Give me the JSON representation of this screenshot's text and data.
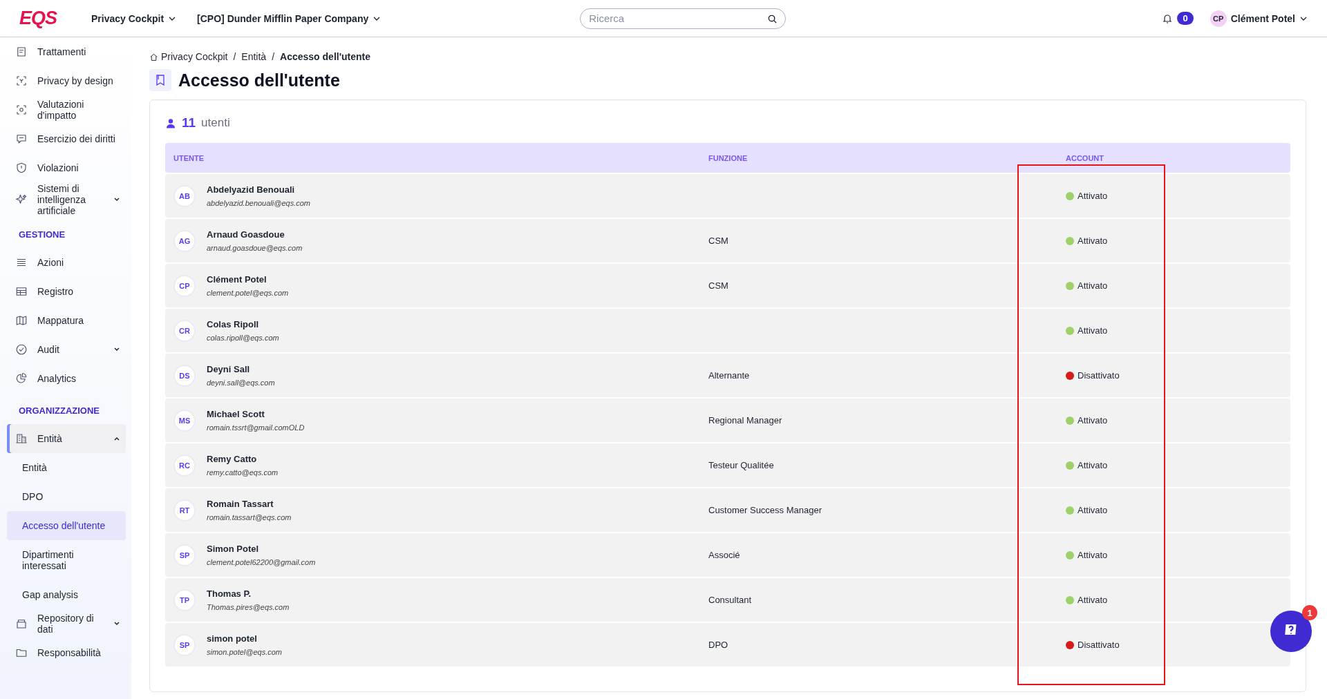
{
  "header": {
    "logo": "EQS",
    "menus": [
      {
        "label": "Privacy Cockpit"
      },
      {
        "label": "[CPO] Dunder Mifflin Paper Company"
      }
    ],
    "search": {
      "placeholder": "Ricerca"
    },
    "notifications": "0",
    "user": {
      "initials": "CP",
      "name": "Clément Potel"
    }
  },
  "sidebar": {
    "items": [
      {
        "kind": "item",
        "label": "Trattamenti",
        "selected": false
      },
      {
        "kind": "item",
        "label": "Privacy by design",
        "selected": false
      },
      {
        "kind": "item",
        "label": "Valutazioni d'impatto",
        "selected": false
      },
      {
        "kind": "item",
        "label": "Esercizio dei diritti",
        "selected": false
      },
      {
        "kind": "item",
        "label": "Violazioni",
        "selected": false
      },
      {
        "kind": "group",
        "label": "Sistemi di intelligenza artificiale",
        "expanded": false,
        "selected": false
      },
      {
        "kind": "section",
        "label": "GESTIONE"
      },
      {
        "kind": "item",
        "label": "Azioni",
        "selected": false
      },
      {
        "kind": "item",
        "label": "Registro",
        "selected": false
      },
      {
        "kind": "item",
        "label": "Mappatura",
        "selected": false
      },
      {
        "kind": "group",
        "label": "Audit",
        "expanded": false,
        "selected": false
      },
      {
        "kind": "item",
        "label": "Analytics",
        "selected": false
      },
      {
        "kind": "section",
        "label": "ORGANIZZAZIONE"
      },
      {
        "kind": "group",
        "label": "Entità",
        "expanded": true,
        "selected": true,
        "children": [
          {
            "label": "Entità",
            "selected": false
          },
          {
            "label": "DPO",
            "selected": false
          },
          {
            "label": "Accesso dell'utente",
            "selected": true
          },
          {
            "label": "Dipartimenti interessati",
            "selected": false
          },
          {
            "label": "Gap analysis",
            "selected": false
          }
        ]
      },
      {
        "kind": "group",
        "label": "Repository di dati",
        "expanded": false,
        "selected": false
      },
      {
        "kind": "item",
        "label": "Responsabilità",
        "selected": false
      }
    ]
  },
  "breadcrumb": {
    "separator": "/",
    "items": [
      {
        "label": "Privacy Cockpit"
      },
      {
        "label": "Entità"
      },
      {
        "label": "Accesso dell'utente"
      }
    ]
  },
  "page_title": "Accesso dell'utente",
  "count": {
    "number": "11",
    "label": "utenti"
  },
  "table": {
    "columns": [
      "UTENTE",
      "FUNZIONE",
      "ACCOUNT"
    ],
    "rows": [
      {
        "initials": "AB",
        "name": "Abdelyazid Benouali",
        "email": "abdelyazid.benouali@eqs.com",
        "function": "",
        "status": "Attivato",
        "color": "#9fd16b"
      },
      {
        "initials": "AG",
        "name": "Arnaud Goasdoue",
        "email": "arnaud.goasdoue@eqs.com",
        "function": "CSM",
        "status": "Attivato",
        "color": "#9fd16b"
      },
      {
        "initials": "CP",
        "name": "Clément Potel",
        "email": "clement.potel@eqs.com",
        "function": "CSM",
        "status": "Attivato",
        "color": "#9fd16b"
      },
      {
        "initials": "CR",
        "name": "Colas Ripoll",
        "email": "colas.ripoll@eqs.com",
        "function": "",
        "status": "Attivato",
        "color": "#9fd16b"
      },
      {
        "initials": "DS",
        "name": "Deyni Sall",
        "email": "deyni.sall@eqs.com",
        "function": "Alternante",
        "status": "Disattivato",
        "color": "#d71a1a"
      },
      {
        "initials": "MS",
        "name": "Michael Scott",
        "email": "romain.tssrt@gmail.comOLD",
        "function": "Regional Manager",
        "status": "Attivato",
        "color": "#9fd16b"
      },
      {
        "initials": "RC",
        "name": "Remy Catto",
        "email": "remy.catto@eqs.com",
        "function": "Testeur Qualitée",
        "status": "Attivato",
        "color": "#9fd16b"
      },
      {
        "initials": "RT",
        "name": "Romain Tassart",
        "email": "romain.tassart@eqs.com",
        "function": "Customer Success Manager",
        "status": "Attivato",
        "color": "#9fd16b"
      },
      {
        "initials": "SP",
        "name": "Simon Potel",
        "email": "clement.potel62200@gmail.com",
        "function": "Associé",
        "status": "Attivato",
        "color": "#9fd16b"
      },
      {
        "initials": "TP",
        "name": "Thomas P.",
        "email": "Thomas.pires@eqs.com",
        "function": "Consultant",
        "status": "Attivato",
        "color": "#9fd16b"
      },
      {
        "initials": "SP",
        "name": "simon potel",
        "email": "simon.potel@eqs.com",
        "function": "DPO",
        "status": "Disattivato",
        "color": "#d71a1a"
      }
    ]
  },
  "help": {
    "badge": "1"
  }
}
